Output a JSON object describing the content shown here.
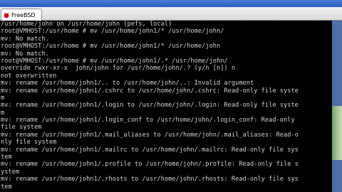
{
  "window": {
    "tab_label": "FreeBSD"
  },
  "console": {
    "lines": [
      "/usr/home/john on /usr/home/john (pefs, local)",
      "root@VMHOST:/usr/home # mv /usr/home/john1/* /usr/home/john/",
      "mv: No match.",
      "root@VMHOST:/usr/home # mv /usr/home/john1/* /usr/home/john",
      "mv: No match.",
      "root@VMHOST:/usr/home # mv /usr/home/john1/.* /usr/home/john/",
      "override rwxr-xr-x  john/john for /usr/home/john/.? (y/n [n]) n",
      "not overwritten",
      "mv: rename /usr/home/john1/.. to /usr/home/john/..: Invalid argument",
      "mv: rename /usr/home/john1/.cshrc to /usr/home/john/.cshrc: Read-only file syste",
      "m",
      "mv: rename /usr/home/john1/.login to /usr/home/john/.login: Read-only file syste",
      "m",
      "mv: rename /usr/home/john1/.login_conf to /usr/home/john/.login_conf: Read-only",
      "file system",
      "mv: rename /usr/home/john1/.mail_aliases to /usr/home/john/.mail_aliases: Read-o",
      "nly file system",
      "mv: rename /usr/home/john1/.mailrc to /usr/home/john/.mailrc: Read-only file sys",
      "tem",
      "mv: rename /usr/home/john1/.profile to /usr/home/john/.profile: Read-only file s",
      "ystem",
      "mv: rename /usr/home/john1/.rhosts to /usr/home/john/.rhosts: Read-only file sys",
      "tem"
    ]
  },
  "colors": {
    "console_bg": "#000000",
    "console_fg": "#d4d4d4",
    "tab_icon_red": "#cc1111"
  }
}
